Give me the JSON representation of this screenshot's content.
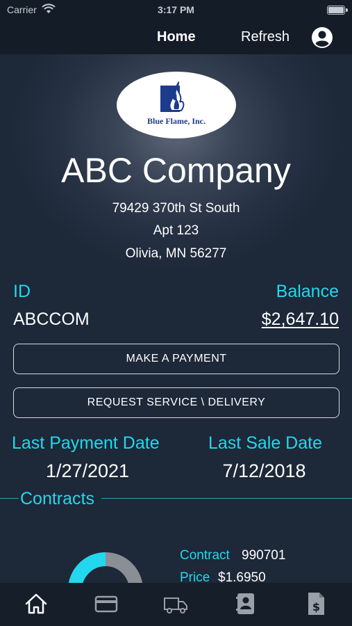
{
  "status_bar": {
    "carrier": "Carrier",
    "time": "3:17 PM"
  },
  "nav": {
    "home_label": "Home",
    "refresh_label": "Refresh",
    "account_icon": "account-circle-icon"
  },
  "logo": {
    "text": "Blue Flame, Inc."
  },
  "customer": {
    "name": "ABC Company",
    "address_line1": "79429 370th St South",
    "address_line2": "Apt 123",
    "address_line3": "Olivia, MN 56277"
  },
  "account": {
    "id_label": "ID",
    "id_value": "ABCCOM",
    "balance_label": "Balance",
    "balance_value": "$2,647.10"
  },
  "actions": {
    "make_payment": "MAKE A PAYMENT",
    "request_service": "REQUEST SERVICE \\ DELIVERY"
  },
  "dates": {
    "last_payment_label": "Last Payment Date",
    "last_payment_value": "1/27/2021",
    "last_sale_label": "Last Sale Date",
    "last_sale_value": "7/12/2018"
  },
  "contracts": {
    "section_label": "Contracts",
    "contract_label": "Contract",
    "contract_value": "990701",
    "price_label": "Price",
    "price_value": "$1.6950",
    "gauge_fill_fraction": 0.5
  },
  "tabs": [
    {
      "icon": "home-icon",
      "selected": true
    },
    {
      "icon": "credit-card-icon",
      "selected": false
    },
    {
      "icon": "truck-icon",
      "selected": false
    },
    {
      "icon": "contact-card-icon",
      "selected": false
    },
    {
      "icon": "invoice-dollar-icon",
      "selected": false
    }
  ],
  "colors": {
    "accent": "#22d8ee",
    "background": "#1b2434",
    "bar_background": "#141c28",
    "gauge_fill": "#22d8ee",
    "gauge_remaining": "#8a8e95",
    "logo_blue": "#1c3b8c"
  }
}
